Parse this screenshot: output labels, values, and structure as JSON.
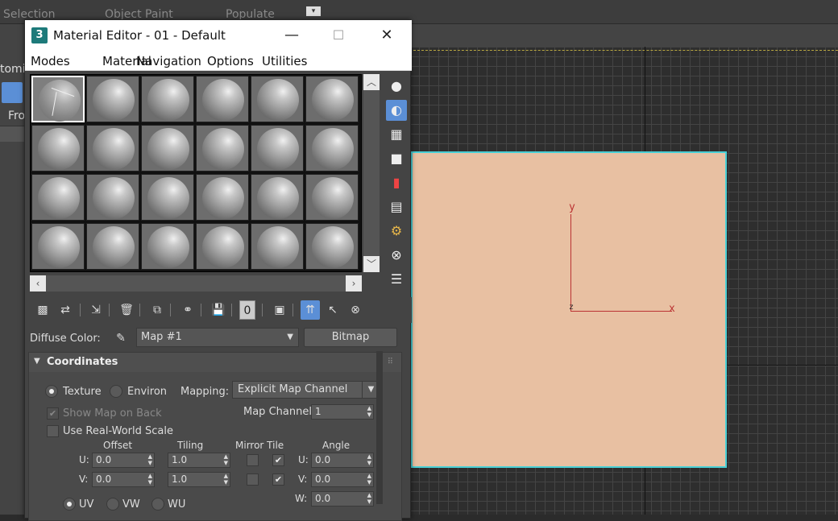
{
  "background": {
    "tabs": [
      "Selection",
      "Object Paint",
      "Populate"
    ],
    "left_labels": [
      "tomiz",
      "Fro"
    ]
  },
  "viewport": {
    "axis_labels": {
      "y": "y",
      "x": "x",
      "z": "z"
    },
    "plane_color": "#e8c0a2",
    "plane_border_color": "#48d0d6"
  },
  "editor": {
    "title": "Material Editor - 01 - Default",
    "app_icon": "3",
    "window_controls": {
      "minimize": "—",
      "maximize": "☐",
      "close": "✕"
    },
    "menu": [
      "Modes",
      "Material",
      "Navigation",
      "Options",
      "Utilities"
    ],
    "slots": {
      "rows": 4,
      "cols": 6,
      "active_index": 0
    },
    "side_tools": [
      "sample-type-icon",
      "backlight-icon",
      "background-icon",
      "sample-uv-tiling-icon",
      "video-color-check-icon",
      "make-preview-icon",
      "options-icon",
      "select-by-material-icon",
      "material-map-navigator-icon"
    ],
    "bottom_tools": [
      "get-material-icon",
      "put-to-scene-icon",
      "assign-to-selection-icon",
      "reset-map-icon",
      "make-unique-icon",
      "put-to-library-icon",
      "save-icon",
      "material-id-channel-icon",
      "show-shaded-material-icon",
      "show-end-result-icon",
      "go-to-parent-icon",
      "go-forward-sibling-icon"
    ],
    "material_id_channel": "0",
    "diffuse": {
      "label": "Diffuse Color:",
      "map_name": "Map #1",
      "map_type": "Bitmap"
    },
    "coordinates": {
      "title": "Coordinates",
      "texture_label": "Texture",
      "environ_label": "Environ",
      "mapping_label": "Mapping:",
      "mapping_value": "Explicit Map Channel",
      "show_map_on_back": "Show Map on Back",
      "map_channel_label": "Map Channel:",
      "map_channel_value": "1",
      "use_real_world_scale": "Use Real-World Scale",
      "headers": {
        "offset": "Offset",
        "tiling": "Tiling",
        "mirror_tile": "Mirror Tile",
        "angle": "Angle"
      },
      "u_label": "U:",
      "v_label": "V:",
      "w_label": "W:",
      "offset_u": "0.0",
      "offset_v": "0.0",
      "tiling_u": "1.0",
      "tiling_v": "1.0",
      "angle_u": "0.0",
      "angle_v": "0.0",
      "angle_w": "0.0",
      "uvw_options": [
        "UV",
        "VW",
        "WU"
      ]
    }
  }
}
